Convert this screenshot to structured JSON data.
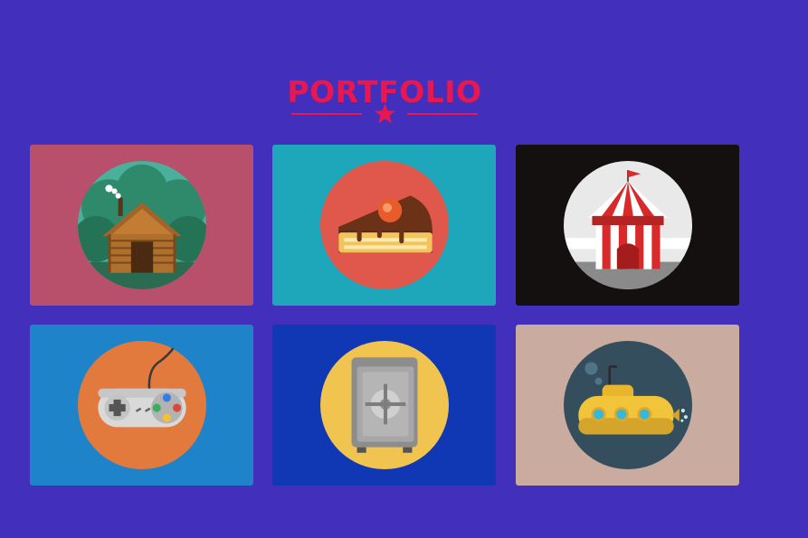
{
  "page": {
    "title": "PORTFOLIO",
    "accent_color": "#e8174f",
    "background_color": "#4230bd"
  },
  "divider": {
    "icon": "star-icon"
  },
  "portfolio_items": [
    {
      "icon": "log-cabin-icon",
      "card_color": "#b84f6b",
      "circle_color": "#4ab09b"
    },
    {
      "icon": "cake-slice-icon",
      "card_color": "#1ea6bb",
      "circle_color": "#e0584b"
    },
    {
      "icon": "circus-tent-icon",
      "card_color": "#141010",
      "circle_color": "#e9e9e9"
    },
    {
      "icon": "game-controller-icon",
      "card_color": "#1f83c9",
      "circle_color": "#e37a3d"
    },
    {
      "icon": "safe-icon",
      "card_color": "#1138b4",
      "circle_color": "#f0c44e"
    },
    {
      "icon": "submarine-icon",
      "card_color": "#c9aba0",
      "circle_color": "#344e5e"
    }
  ]
}
